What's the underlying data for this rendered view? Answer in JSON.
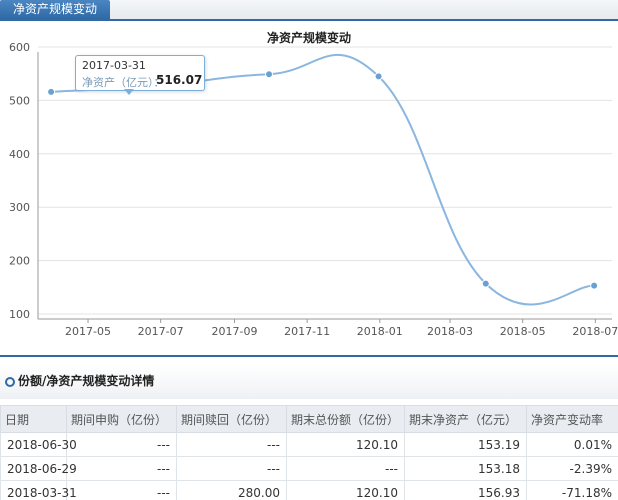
{
  "tab": {
    "label": "净资产规模变动"
  },
  "tooltip": {
    "date": "2017-03-31",
    "label": "净资产（亿元）：",
    "value": "516.07"
  },
  "chart_data": {
    "type": "line",
    "title": "净资产规模变动",
    "x_tick_labels": [
      "2017-05",
      "2017-07",
      "2017-09",
      "2017-11",
      "2018-01",
      "2018-03",
      "2018-05",
      "2018-07"
    ],
    "y_tick_labels": [
      "100",
      "200",
      "300",
      "400",
      "500",
      "600"
    ],
    "ylim": [
      100,
      600
    ],
    "grid": true,
    "series": [
      {
        "name": "净资产（亿元）",
        "points": [
          {
            "x": "2017-03-31",
            "y": 516.07
          },
          {
            "x": "2017-06-30",
            "y": 528
          },
          {
            "x": "2017-09-30",
            "y": 549
          },
          {
            "x": "2017-12-31",
            "y": 545
          },
          {
            "x": "2018-03-31",
            "y": 156.93
          },
          {
            "x": "2018-06-30",
            "y": 153.19
          }
        ]
      }
    ],
    "colors": {
      "line": "#8ab6df",
      "marker": "#6aa0d2",
      "grid": "#e3e3e3"
    }
  },
  "section": {
    "title": "份额/净资产规模变动详情"
  },
  "table": {
    "headers": [
      "日期",
      "期间申购（亿份）",
      "期间赎回（亿份）",
      "期末总份额（亿份）",
      "期末净资产（亿元）",
      "净资产变动率"
    ],
    "rows": [
      [
        "2018-06-30",
        "---",
        "---",
        "120.10",
        "153.19",
        "0.01%"
      ],
      [
        "2018-06-29",
        "---",
        "---",
        "---",
        "153.18",
        "-2.39%"
      ],
      [
        "2018-03-31",
        "---",
        "280.00",
        "120.10",
        "156.93",
        "-71.18%"
      ]
    ]
  }
}
